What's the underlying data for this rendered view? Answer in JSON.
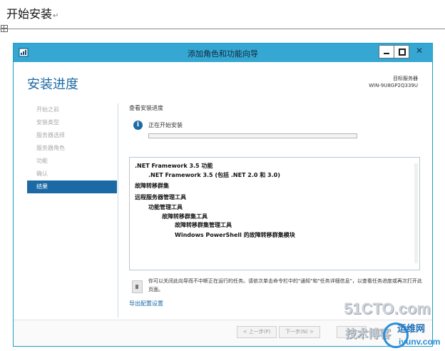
{
  "document": {
    "heading": "开始安装",
    "paragraph_mark": "↵"
  },
  "window": {
    "title": "添加角色和功能向导",
    "controls": {
      "minimize": "",
      "maximize": "",
      "close": "✕"
    }
  },
  "page": {
    "title": "安装进度",
    "server_label": "目标服务器",
    "server_name": "WIN-9U8GP2Q339U"
  },
  "nav": {
    "items": [
      {
        "label": "开始之前",
        "active": false
      },
      {
        "label": "安装类型",
        "active": false
      },
      {
        "label": "服务器选择",
        "active": false
      },
      {
        "label": "服务器角色",
        "active": false
      },
      {
        "label": "功能",
        "active": false
      },
      {
        "label": "确认",
        "active": false
      },
      {
        "label": "结果",
        "active": true
      }
    ]
  },
  "main": {
    "section_label": "查看安装进度",
    "status_text": "正在开始安装",
    "progress": 0,
    "results": [
      {
        "text": ".NET Framework 3.5 功能",
        "indent": 0
      },
      {
        "text": ".NET Framework 3.5 (包括 .NET 2.0 和 3.0)",
        "indent": 1
      },
      {
        "text": "故障转移群集",
        "indent": 0
      },
      {
        "text": "远程服务器管理工具",
        "indent": 0
      },
      {
        "text": "功能管理工具",
        "indent": 1
      },
      {
        "text": "故障转移群集工具",
        "indent": 2
      },
      {
        "text": "故障转移群集管理工具",
        "indent": 3
      },
      {
        "text": "Windows PowerShell 的故障转移群集模块",
        "indent": 3
      }
    ],
    "note": "你可以关闭此向导而不中断正在运行的任务。请依次单击命令栏中的\"通知\"和\"任务详细信息\"，以查看任务进度或再次打开此页面。",
    "export_link": "导出配置设置"
  },
  "footer": {
    "prev": "< 上一步(P)",
    "next": "下一步(N) >",
    "finish": "安装"
  },
  "watermark": {
    "site": "51CTO.com",
    "tagline": "技术博客",
    "brand_cn": "运维网",
    "brand_url": "iyunv.com"
  }
}
